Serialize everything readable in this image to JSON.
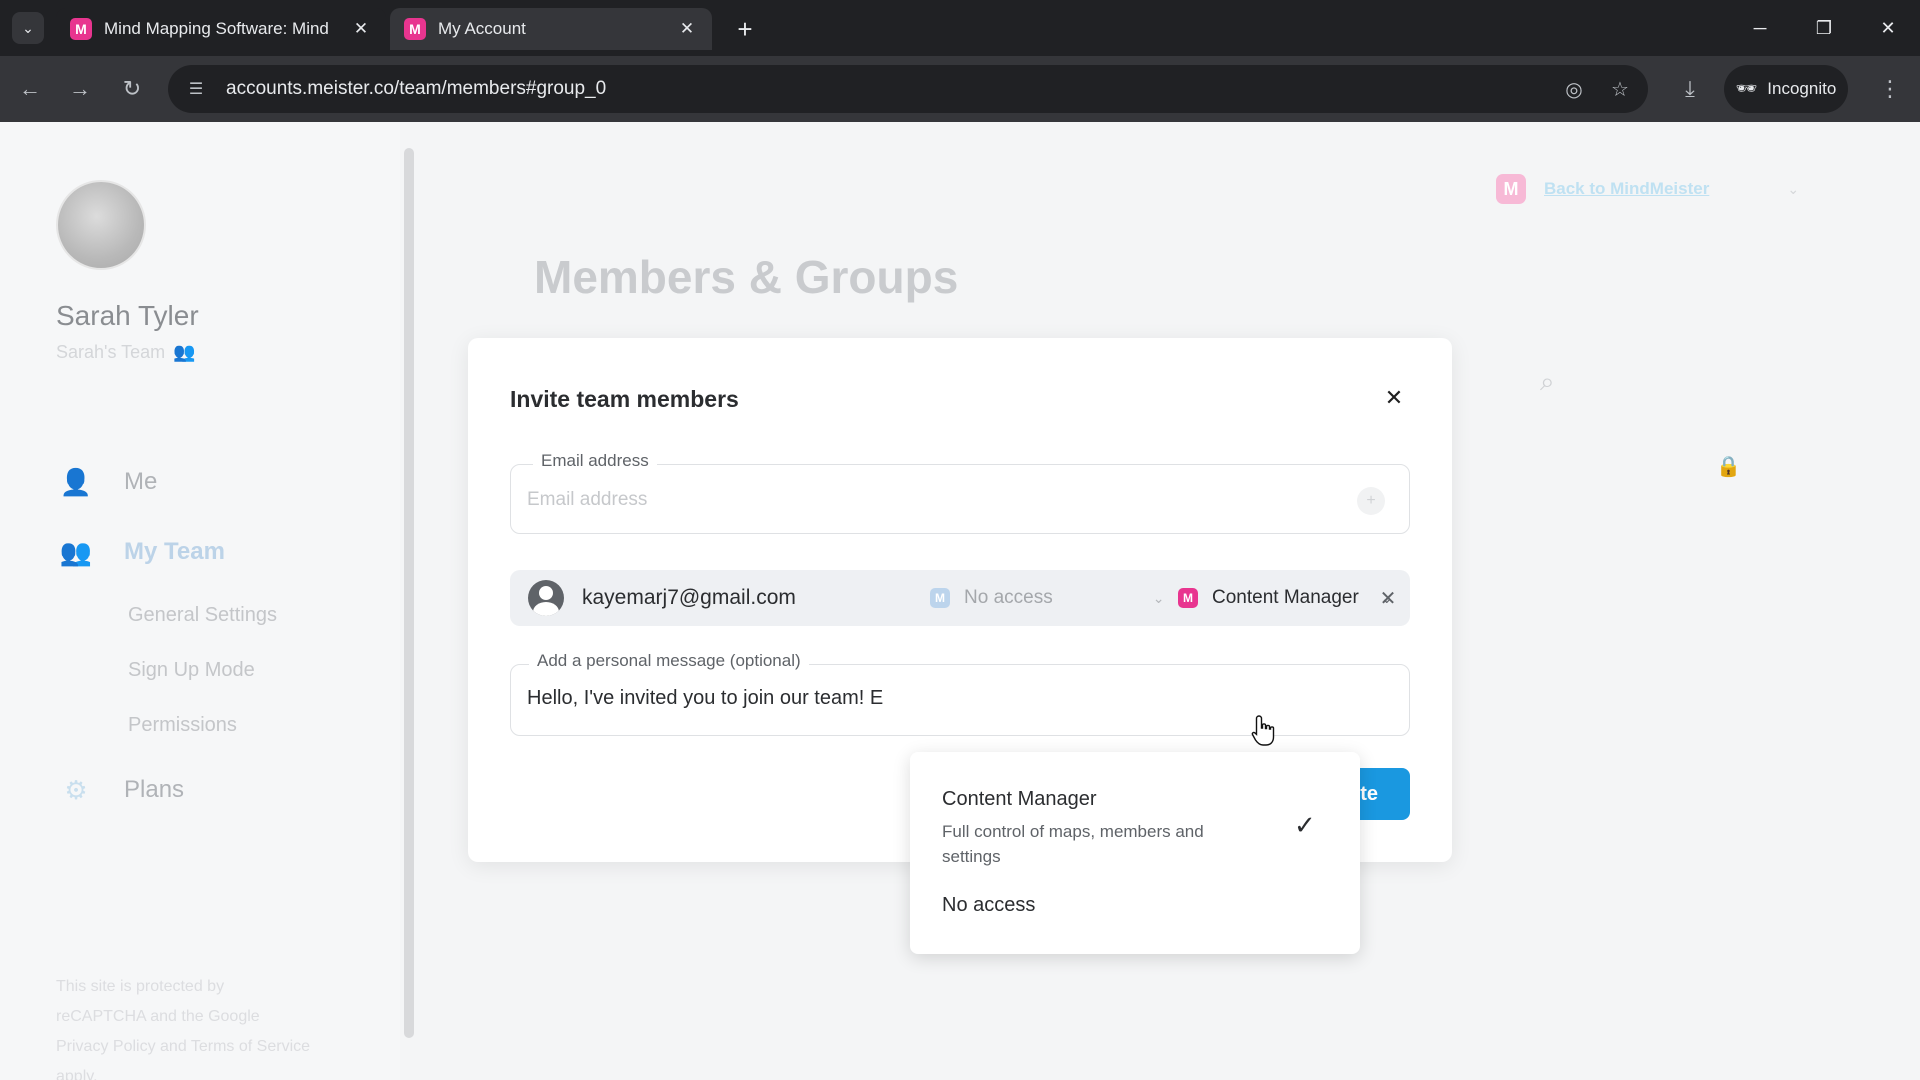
{
  "browser": {
    "tabs": [
      {
        "title": "Mind Mapping Software: Mind",
        "favicon": "M"
      },
      {
        "title": "My Account",
        "favicon": "M"
      }
    ],
    "url": "accounts.meister.co/team/members#group_0",
    "incognito_label": "Incognito"
  },
  "sidebar": {
    "user_name": "Sarah Tyler",
    "team_name": "Sarah's Team",
    "nav": [
      {
        "label": "Me",
        "icon": "person-icon"
      },
      {
        "label": "My Team",
        "icon": "team-icon",
        "active": true
      },
      {
        "label": "Plans",
        "icon": "gear-icon"
      }
    ],
    "subitems": [
      "General Settings",
      "Sign Up Mode",
      "Permissions"
    ],
    "recaptcha": [
      "This site is protected by",
      "reCAPTCHA and the Google",
      "Privacy Policy and Terms of Service",
      "apply."
    ]
  },
  "header": {
    "back_link": "Back to MindMeister",
    "page_title": "Members & Groups"
  },
  "modal": {
    "title": "Invite team members",
    "email_label": "Email address",
    "email_placeholder": "Email address",
    "invitee": {
      "email": "kayemarj7@gmail.com",
      "app_access": "No access",
      "role": "Content Manager"
    },
    "message_label": "Add a personal message (optional)",
    "message_text": "Hello, I've invited you to join our team! E",
    "invite_button": "te"
  },
  "dropdown": {
    "options": [
      {
        "title": "Content Manager",
        "description": "Full control of maps, members and settings",
        "selected": true
      },
      {
        "title": "No access",
        "description": "",
        "selected": false
      }
    ]
  },
  "colors": {
    "brand_pink": "#e8358f",
    "primary_blue": "#1a98e0"
  }
}
